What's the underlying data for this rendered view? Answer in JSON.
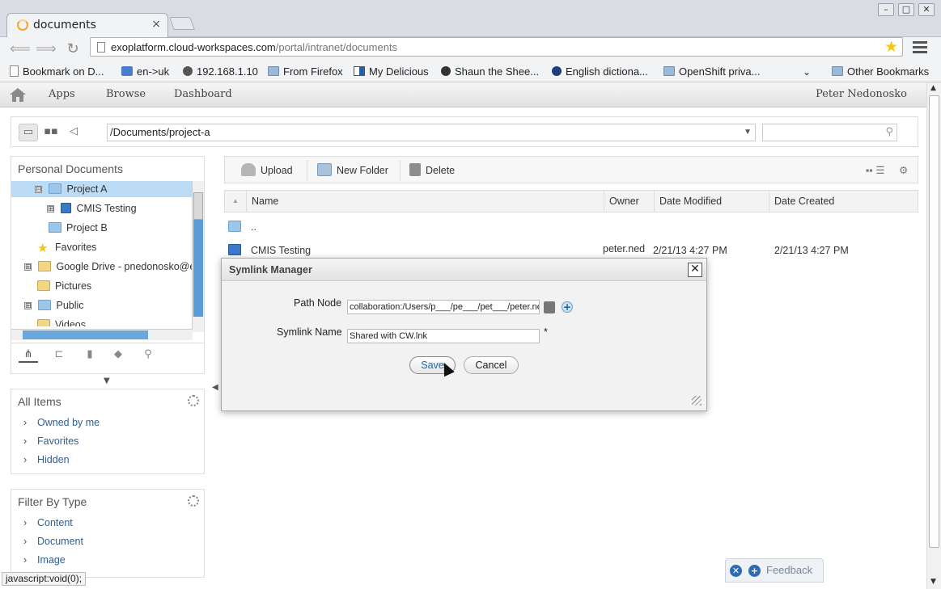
{
  "browser": {
    "tab_title": "documents",
    "tab_close": "×",
    "url_host": "exoplatform.cloud-workspaces.com",
    "url_path": "/portal/intranet/documents",
    "window_buttons": [
      "–",
      "□",
      "✕"
    ],
    "bookmarks": [
      {
        "label": "Bookmark on D...",
        "icon": "page-icon"
      },
      {
        "label": "en->uk",
        "icon": "translate-icon"
      },
      {
        "label": "192.168.1.10",
        "icon": "router-icon"
      },
      {
        "label": "From Firefox",
        "icon": "folder-icon"
      },
      {
        "label": "My Delicious",
        "icon": "delicious-icon"
      },
      {
        "label": "Shaun the Shee...",
        "icon": "sheep-icon"
      },
      {
        "label": "English dictiona...",
        "icon": "dictionary-icon"
      },
      {
        "label": "OpenShift priva...",
        "icon": "folder-icon"
      }
    ],
    "other_bookmarks": "Other Bookmarks"
  },
  "exo_nav": {
    "links": [
      "Apps",
      "Browse",
      "Dashboard"
    ],
    "user": "Peter Nedonosko"
  },
  "address": {
    "path": "/Documents/project-a",
    "search_placeholder": ""
  },
  "left_panel": {
    "title": "Personal Documents",
    "tree": [
      {
        "label": "Project A",
        "selected": true,
        "expander": "⊟",
        "icon": "folder-open-icon"
      },
      {
        "label": "CMIS Testing",
        "expander": "⊞",
        "icon": "document-link-icon"
      },
      {
        "label": "Project B",
        "icon": "folder-icon"
      },
      {
        "label": "Favorites",
        "icon": "star-icon"
      },
      {
        "label": "Google Drive - pnedonosko@e",
        "expander": "⊞",
        "icon": "folder-icon"
      },
      {
        "label": "Pictures",
        "icon": "pictures-folder-icon"
      },
      {
        "label": "Public",
        "expander": "⊞",
        "icon": "folder-icon"
      },
      {
        "label": "Videos",
        "icon": "videos-folder-icon"
      }
    ],
    "all_items": {
      "title": "All Items",
      "items": [
        "Owned by me",
        "Favorites",
        "Hidden"
      ]
    },
    "filter_by_type": {
      "title": "Filter By Type",
      "items": [
        "Content",
        "Document",
        "Image"
      ]
    }
  },
  "action_bar": {
    "upload": "Upload",
    "new_folder": "New Folder",
    "delete": "Delete"
  },
  "file_list": {
    "columns": [
      "Name",
      "Owner",
      "Date Modified",
      "Date Created"
    ],
    "rows": [
      {
        "name": "..",
        "owner": "",
        "modified": "",
        "created": ""
      },
      {
        "name": "CMIS Testing",
        "owner": "peter.ned",
        "modified": "2/21/13 4:27 PM",
        "created": "2/21/13 4:27 PM"
      }
    ]
  },
  "dialog": {
    "title": "Symlink Manager",
    "path_node_label": "Path Node",
    "path_node_value": "collaboration:/Users/p___/pe___/pet___/peter.ne",
    "symlink_name_label": "Symlink Name",
    "symlink_name_value": "Shared with CW.lnk",
    "required_mark": "*",
    "save": "Save",
    "cancel": "Cancel"
  },
  "status_bar": "javascript:void(0);",
  "feedback": "Feedback",
  "colors": {
    "accent": "#1a63b8",
    "selection": "#bcdcf5",
    "link": "#2f5e8e"
  }
}
